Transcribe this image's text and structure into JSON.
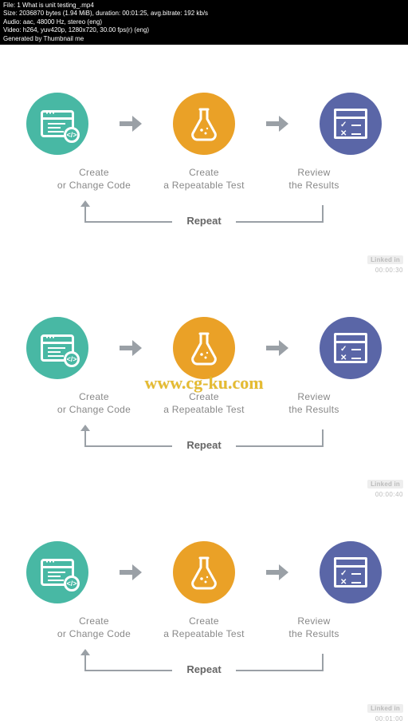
{
  "meta": {
    "line1": "File: 1 What is unit testing_.mp4",
    "line2": "Size: 2036870 bytes (1.94 MiB), duration: 00:01:25, avg.bitrate: 192 kb/s",
    "line3": "Audio: aac, 48000 Hz, stereo (eng)",
    "line4": "Video: h264, yuv420p, 1280x720, 30.00 fps(r) (eng)",
    "line5": "Generated by Thumbnail me"
  },
  "diagram": {
    "steps": [
      {
        "line1": "Create",
        "line2": "or Change Code"
      },
      {
        "line1": "Create",
        "line2": "a Repeatable Test"
      },
      {
        "line1": "Review",
        "line2": "the Results"
      }
    ],
    "repeat_label": "Repeat"
  },
  "frames": [
    {
      "timestamp": "00:00:30",
      "provider": "Linked in",
      "cgku": false
    },
    {
      "timestamp": "00:00:40",
      "provider": "Linked in",
      "cgku": true,
      "cgku_text": "www.cg-ku.com"
    },
    {
      "timestamp": "00:01:00",
      "provider": "Linked in",
      "cgku": false
    }
  ],
  "colors": {
    "teal": "#48b8a4",
    "orange": "#eaa127",
    "purple": "#5a66a7",
    "arrow": "#9aa0a6",
    "label": "#888"
  }
}
